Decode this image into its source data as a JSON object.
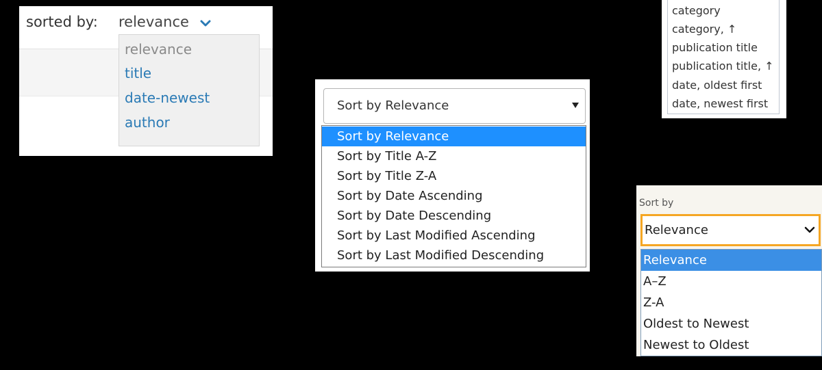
{
  "panel1": {
    "label": "sorted by:",
    "selected": "relevance",
    "options": [
      "relevance",
      "title",
      "date-newest",
      "author"
    ],
    "accent": "#2a7ab5"
  },
  "panel2": {
    "selected": "Sort by Relevance",
    "options": [
      "Sort by Relevance",
      "Sort by Title A-Z",
      "Sort by Title Z-A",
      "Sort by Date Ascending",
      "Sort by Date Descending",
      "Sort by Last Modified Ascending",
      "Sort by Last Modified Descending"
    ],
    "highlight": "#1e90ff"
  },
  "panel3": {
    "options": [
      "category",
      "category, ↑",
      "publication title",
      "publication title, ↑",
      "date, oldest first",
      "date, newest first"
    ]
  },
  "panel4": {
    "label": "Sort by",
    "selected": "Relevance",
    "options": [
      "Relevance",
      "A–Z",
      "Z-A",
      "Oldest to Newest",
      "Newest to Oldest"
    ],
    "focus_color": "#f5a623",
    "highlight": "#3b8fe5"
  }
}
